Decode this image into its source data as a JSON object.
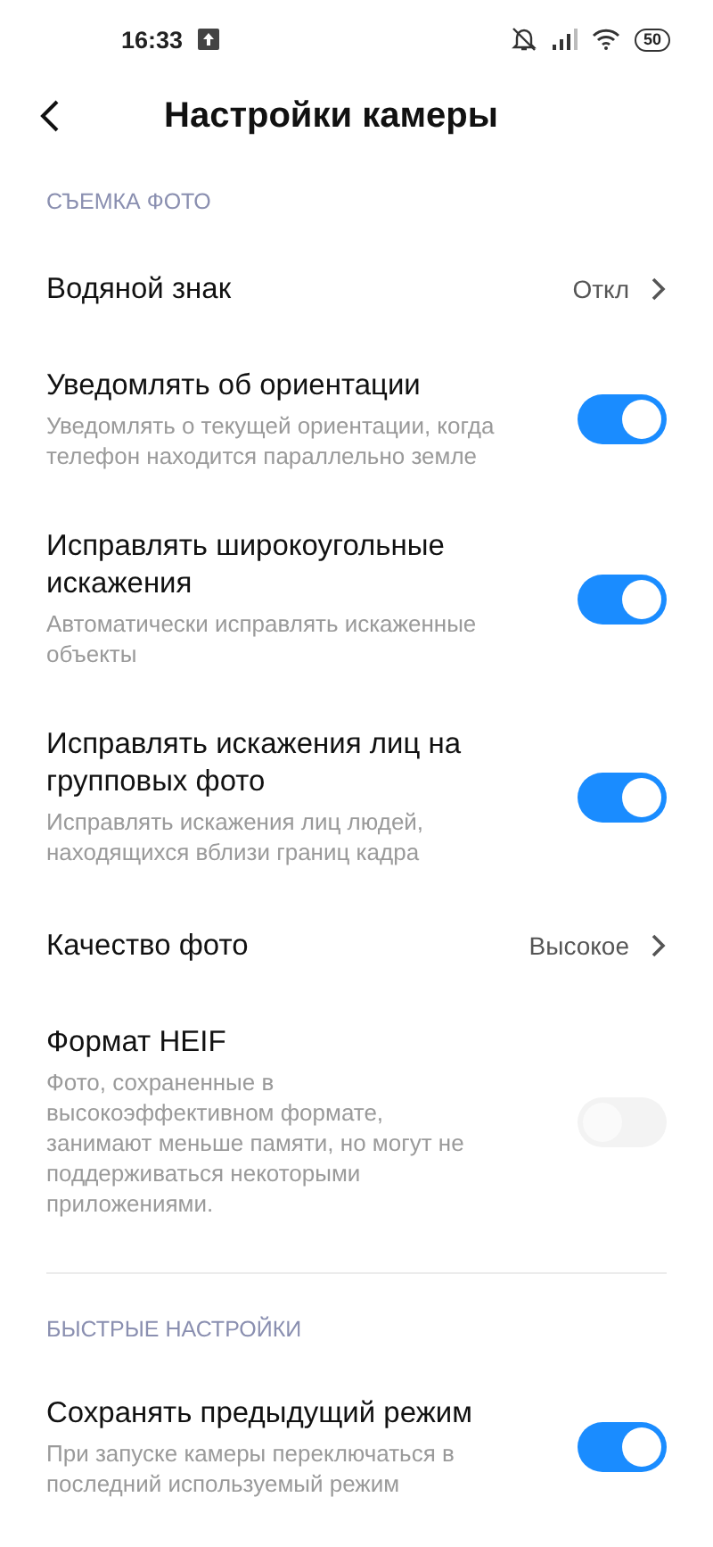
{
  "status_bar": {
    "time": "16:33",
    "battery": "50"
  },
  "header": {
    "title": "Настройки камеры"
  },
  "sections": [
    {
      "title": "СЪЕМКА ФОТО",
      "items": [
        {
          "kind": "link",
          "label": "Водяной знак",
          "value": "Откл"
        },
        {
          "kind": "toggle",
          "label": "Уведомлять об ориентации",
          "description": "Уведомлять о текущей ориентации, когда телефон находится параллельно земле",
          "on": true,
          "disabled": false
        },
        {
          "kind": "toggle",
          "label": "Исправлять широкоугольные искажения",
          "description": "Автоматически исправлять искаженные объекты",
          "on": true,
          "disabled": false
        },
        {
          "kind": "toggle",
          "label": "Исправлять искажения лиц на групповых фото",
          "description": "Исправлять искажения лиц людей, находящихся вблизи границ кадра",
          "on": true,
          "disabled": false
        },
        {
          "kind": "link",
          "label": "Качество фото",
          "value": "Высокое"
        },
        {
          "kind": "toggle",
          "label": "Формат HEIF",
          "description": "Фото, сохраненные в высокоэффективном формате, занимают меньше памяти, но могут не поддерживаться некоторыми приложениями.",
          "on": false,
          "disabled": true
        }
      ]
    },
    {
      "title": "БЫСТРЫЕ НАСТРОЙКИ",
      "items": [
        {
          "kind": "toggle",
          "label": "Сохранять предыдущий режим",
          "description": "При запуске камеры переключаться в последний используемый режим",
          "on": true,
          "disabled": false
        }
      ]
    }
  ]
}
